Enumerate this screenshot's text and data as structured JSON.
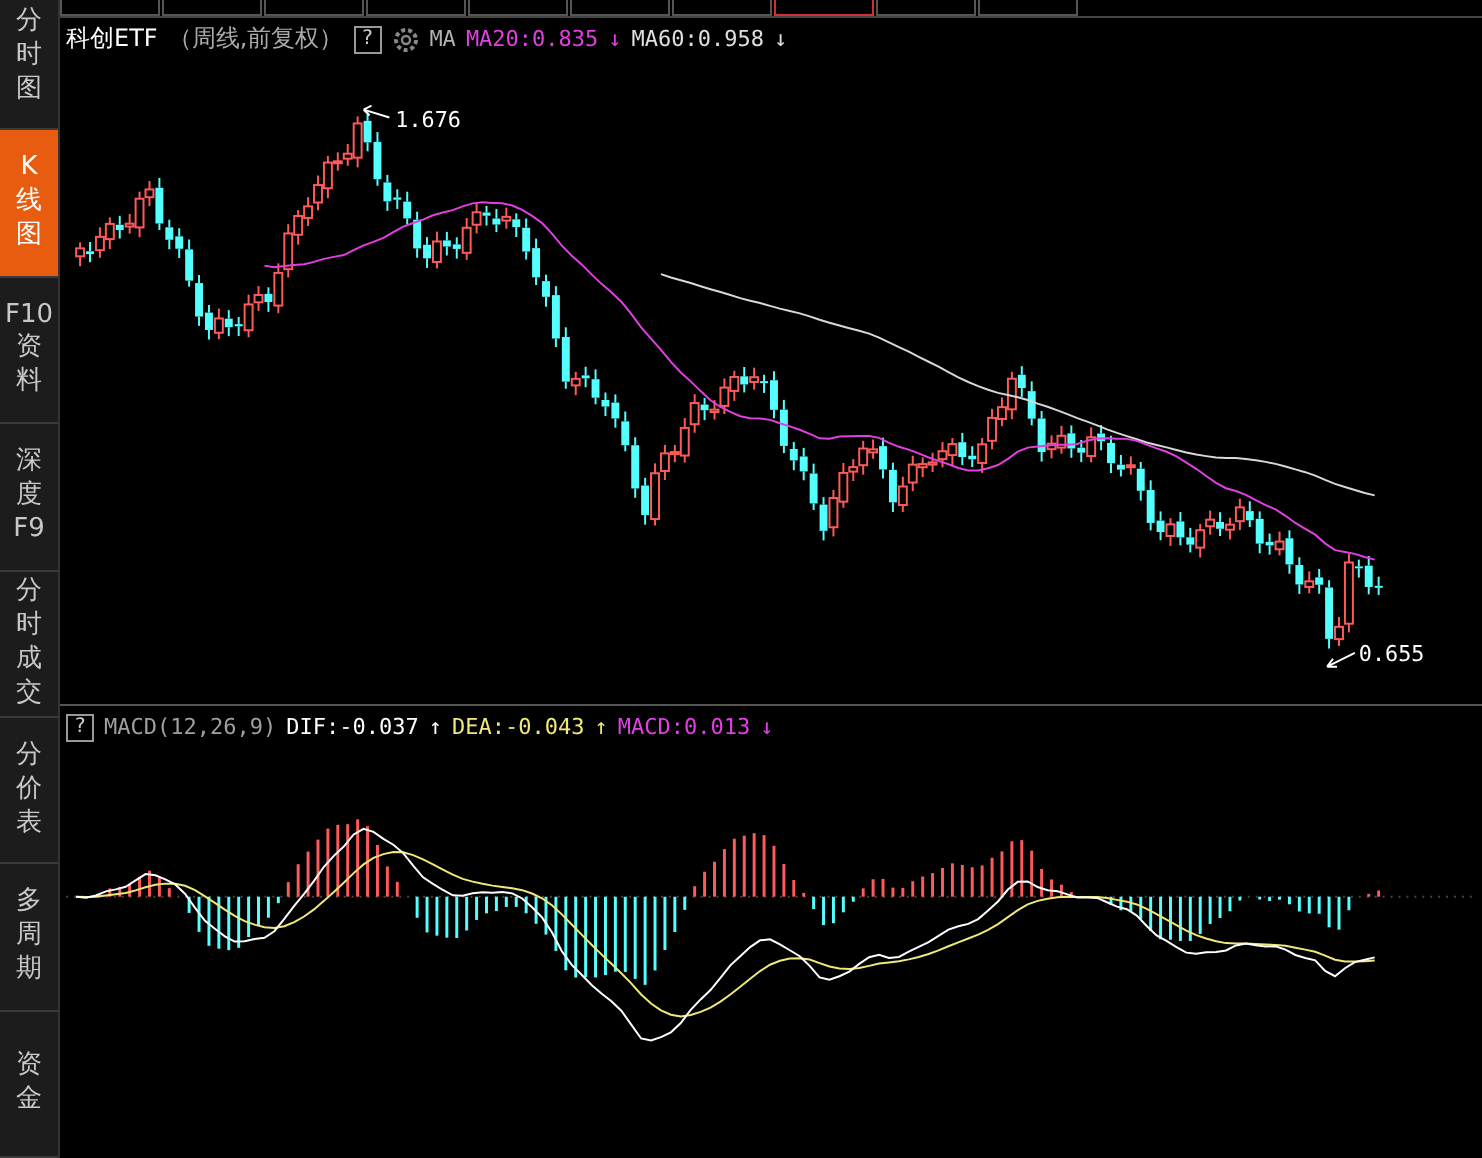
{
  "sidebar": {
    "items": [
      {
        "lines": [
          "分",
          "时",
          "图"
        ],
        "selected": false
      },
      {
        "lines": [
          "K",
          "线",
          "图"
        ],
        "selected": true
      },
      {
        "lines": [
          "F10",
          "资",
          "料"
        ],
        "selected": false
      },
      {
        "lines": [
          "深",
          "度",
          "F9"
        ],
        "selected": false
      },
      {
        "lines": [
          "分",
          "时",
          "成",
          "交"
        ],
        "selected": false
      },
      {
        "lines": [
          "分",
          "价",
          "表"
        ],
        "selected": false
      },
      {
        "lines": [
          "多",
          "周",
          "期"
        ],
        "selected": false
      },
      {
        "lines": [
          "资",
          "金"
        ],
        "selected": false
      }
    ]
  },
  "period_tabs": [
    {
      "selected": false
    },
    {
      "selected": false
    },
    {
      "selected": false
    },
    {
      "selected": false
    },
    {
      "selected": false
    },
    {
      "selected": false
    },
    {
      "selected": false
    },
    {
      "selected": true
    },
    {
      "selected": false
    },
    {
      "selected": false
    }
  ],
  "main_chart": {
    "title": "科创ETF",
    "subtitle": "（周线,前复权）",
    "help": "?",
    "indicators": [
      {
        "label": "MA",
        "color": "#b0b0b0"
      },
      {
        "label": "MA20:0.835",
        "color": "#e040e0",
        "arrow": "↓"
      },
      {
        "label": "MA60:0.958",
        "color": "#e0e0e0",
        "arrow": "↓"
      }
    ],
    "high_label": "1.676",
    "low_label": "0.655"
  },
  "macd_panel": {
    "help": "?",
    "indicators": [
      {
        "label": "MACD(12,26,9)",
        "color": "#a0a0a0"
      },
      {
        "label": "DIF:-0.037",
        "color": "#ffffff",
        "arrow": "↑"
      },
      {
        "label": "DEA:-0.043",
        "color": "#f0e878",
        "arrow": "↑"
      },
      {
        "label": "MACD:0.013",
        "color": "#e040e0",
        "arrow": "↓"
      }
    ]
  }
}
